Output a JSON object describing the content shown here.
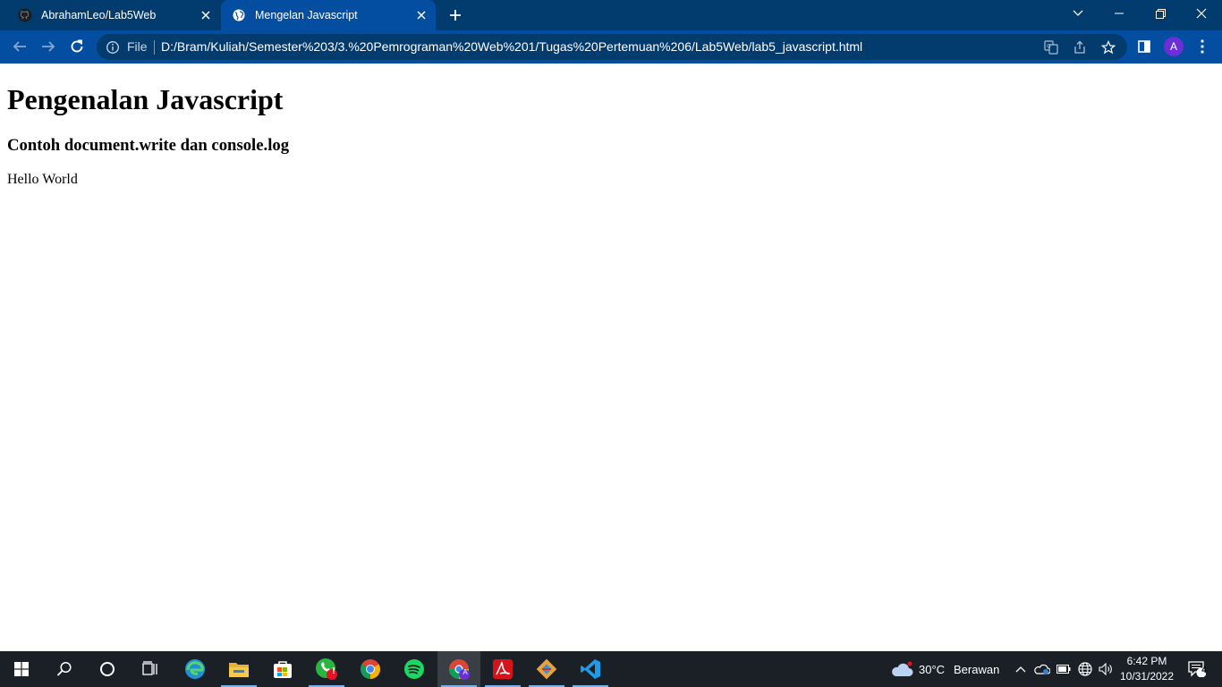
{
  "browser": {
    "tabs": [
      {
        "title": "AbrahamLeo/Lab5Web",
        "icon": "github-icon",
        "active": false
      },
      {
        "title": "Mengelan Javascript",
        "icon": "globe-icon",
        "active": true
      }
    ],
    "address": {
      "scheme_label": "File",
      "url": "D:/Bram/Kuliah/Semester%203/3.%20Pemrograman%20Web%201/Tugas%20Pertemuan%206/Lab5Web/lab5_javascript.html"
    },
    "profile_initial": "A"
  },
  "page": {
    "heading": "Pengenalan Javascript",
    "subheading": "Contoh document.write dan console.log",
    "body_text": "Hello World"
  },
  "taskbar": {
    "weather": {
      "temp": "30°C",
      "condition": "Berawan"
    },
    "clock": {
      "time": "6:42 PM",
      "date": "10/31/2022"
    },
    "notification_count": "4",
    "whatsapp_badge": "!",
    "apps": [
      "start-icon",
      "search-icon",
      "cortana-icon",
      "task-view-icon",
      "edge-icon",
      "file-explorer-icon",
      "store-icon",
      "whatsapp-icon",
      "chrome-icon",
      "chrome-profile-icon",
      "acrobat-icon",
      "git-icon",
      "vscode-icon"
    ]
  },
  "colors": {
    "titlebar": "#023b6e",
    "toolbar": "#044ea1",
    "taskbar": "#1b2027"
  }
}
